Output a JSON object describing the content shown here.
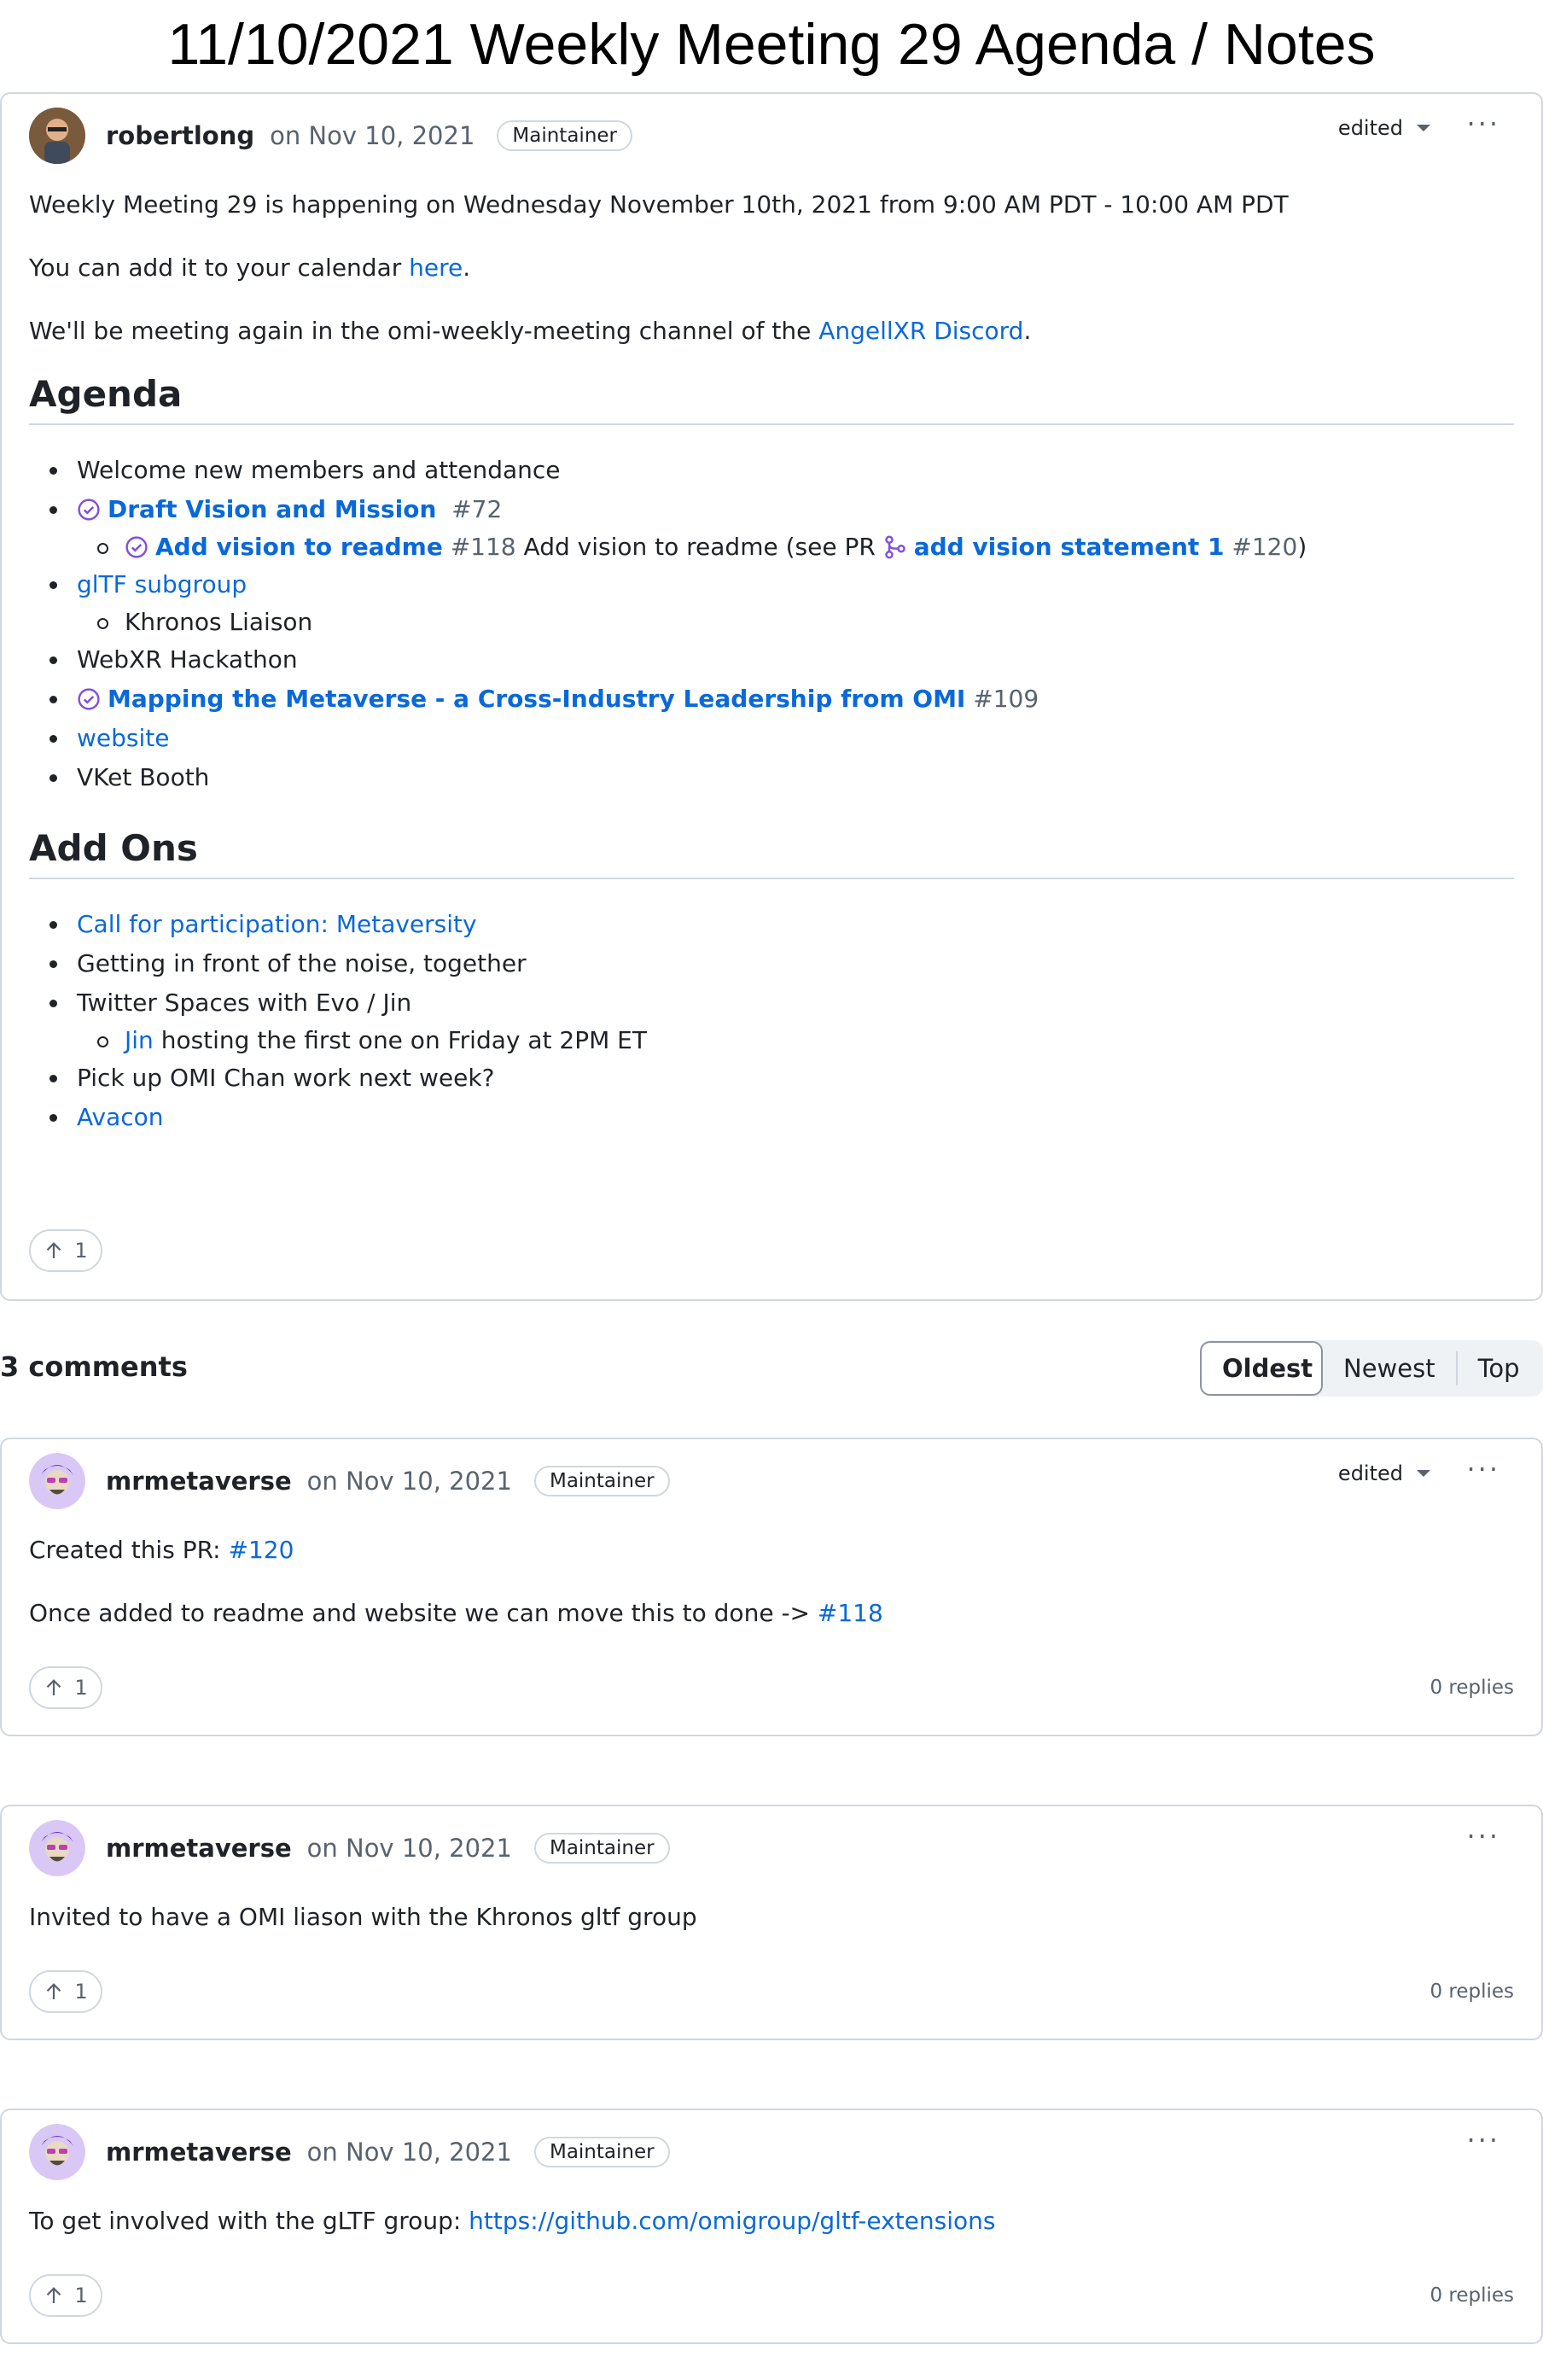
{
  "page": {
    "title": "11/10/2021 Weekly Meeting 29 Agenda / Notes"
  },
  "post": {
    "author": "robertlong",
    "date": "on Nov 10, 2021",
    "badge": "Maintainer",
    "edited": "edited",
    "intro": "Weekly Meeting 29 is happening on Wednesday November 10th, 2021 from 9:00 AM PDT - 10:00 AM PDT",
    "calendar_prefix": "You can add it to your calendar ",
    "calendar_link": "here",
    "calendar_suffix": ".",
    "meeting_prefix": "We'll be meeting again in the omi-weekly-meeting channel of the ",
    "meeting_link": "AngellXR Discord",
    "meeting_suffix": ".",
    "agenda_heading": "Agenda",
    "agenda": {
      "item1": "Welcome new members and attendance",
      "item2_title": "Draft Vision and Mission",
      "item2_num": "#72",
      "item2_sub_title": "Add vision to readme",
      "item2_sub_num": "#118",
      "item2_sub_text": " Add vision to readme (see PR ",
      "item2_sub_pr_title": "add vision statement 1",
      "item2_sub_pr_num": "#120",
      "item2_sub_close": ")",
      "item3": "glTF subgroup",
      "item3_sub": "Khronos Liaison",
      "item4": "WebXR Hackathon",
      "item5_title": "Mapping the Metaverse - a Cross-Industry Leadership from OMI",
      "item5_num": "#109",
      "item6": "website",
      "item7": "VKet Booth"
    },
    "addons_heading": "Add Ons",
    "addons": {
      "item1": "Call for participation: Metaversity",
      "item2": "Getting in front of the noise, together",
      "item3": "Twitter Spaces with Evo / Jin",
      "item3_sub_link": "Jin",
      "item3_sub_text": " hosting the first one on Friday at 2PM ET",
      "item4": "Pick up OMI Chan work next week?",
      "item5": "Avacon"
    },
    "votes": "1"
  },
  "comments_header": {
    "count": "3 comments",
    "sort": [
      "Oldest",
      "Newest",
      "Top"
    ],
    "active_sort": "Oldest"
  },
  "comments": [
    {
      "author": "mrmetaverse",
      "date": "on Nov 10, 2021",
      "badge": "Maintainer",
      "edited": "edited",
      "line1_prefix": "Created this PR: ",
      "line1_link": "#120",
      "line2_prefix": "Once added to readme and website we can move this to done -> ",
      "line2_link": "#118",
      "votes": "1",
      "replies": "0 replies"
    },
    {
      "author": "mrmetaverse",
      "date": "on Nov 10, 2021",
      "badge": "Maintainer",
      "line1_prefix": "Invited to have a OMI liason with the Khronos gltf group",
      "votes": "1",
      "replies": "0 replies"
    },
    {
      "author": "mrmetaverse",
      "date": "on Nov 10, 2021",
      "badge": "Maintainer",
      "line1_prefix": "To get involved with the gLTF group: ",
      "line1_link": "https://github.com/omigroup/gltf-extensions",
      "votes": "1",
      "replies": "0 replies"
    }
  ],
  "colors": {
    "link": "#0969da",
    "border": "#d0d7de",
    "muted": "#59636e",
    "done_purple": "#8250df"
  },
  "icons": [
    "issue-closed-icon",
    "pull-request-merged-icon",
    "arrow-up-icon",
    "kebab-horizontal-icon",
    "caret-down-icon"
  ]
}
